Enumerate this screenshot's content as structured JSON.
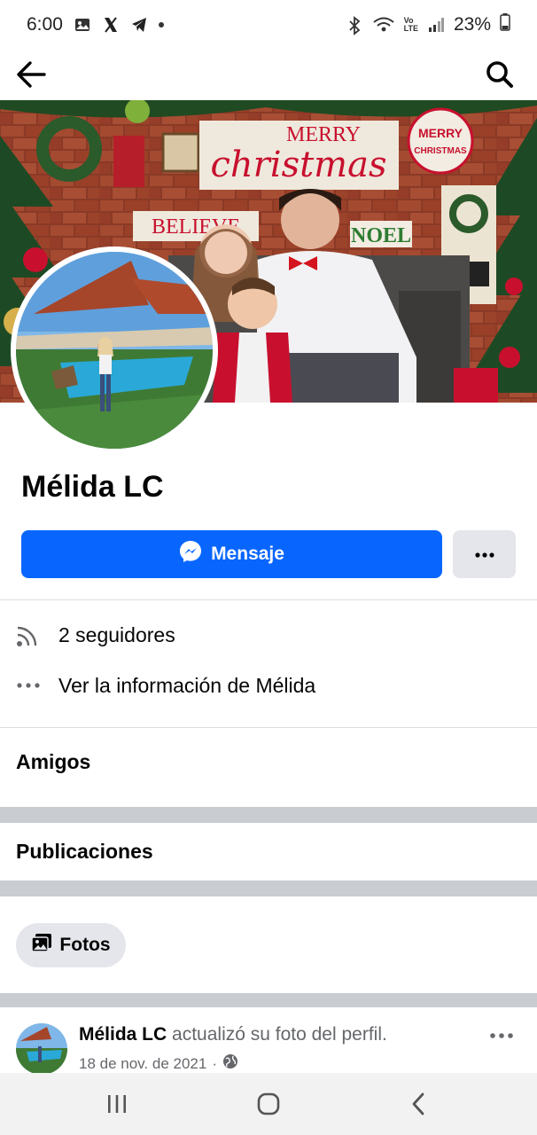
{
  "status_bar": {
    "time": "6:00",
    "battery": "23%"
  },
  "profile": {
    "name": "Mélida LC"
  },
  "actions": {
    "message_label": "Mensaje"
  },
  "info": {
    "followers": "2 seguidores",
    "see_info": "Ver la información de Mélida"
  },
  "sections": {
    "friends": "Amigos",
    "posts": "Publicaciones"
  },
  "filters": {
    "photos": "Fotos"
  },
  "post": {
    "author": "Mélida LC",
    "action": "actualizó su foto del perfil.",
    "date": "18 de nov. de 2021"
  },
  "cover_signs": {
    "merry": "MERRY",
    "christmas": "christmas",
    "badge_1": "MERRY",
    "badge_2": "CHRISTMAS",
    "believe": "BELIEVE",
    "noel": "NOEL"
  },
  "colors": {
    "brand_blue": "#0866ff",
    "secondary_button": "#e4e6eb",
    "divider": "#dadde1",
    "band": "#c9ccd1",
    "meta_text": "#65676b"
  }
}
